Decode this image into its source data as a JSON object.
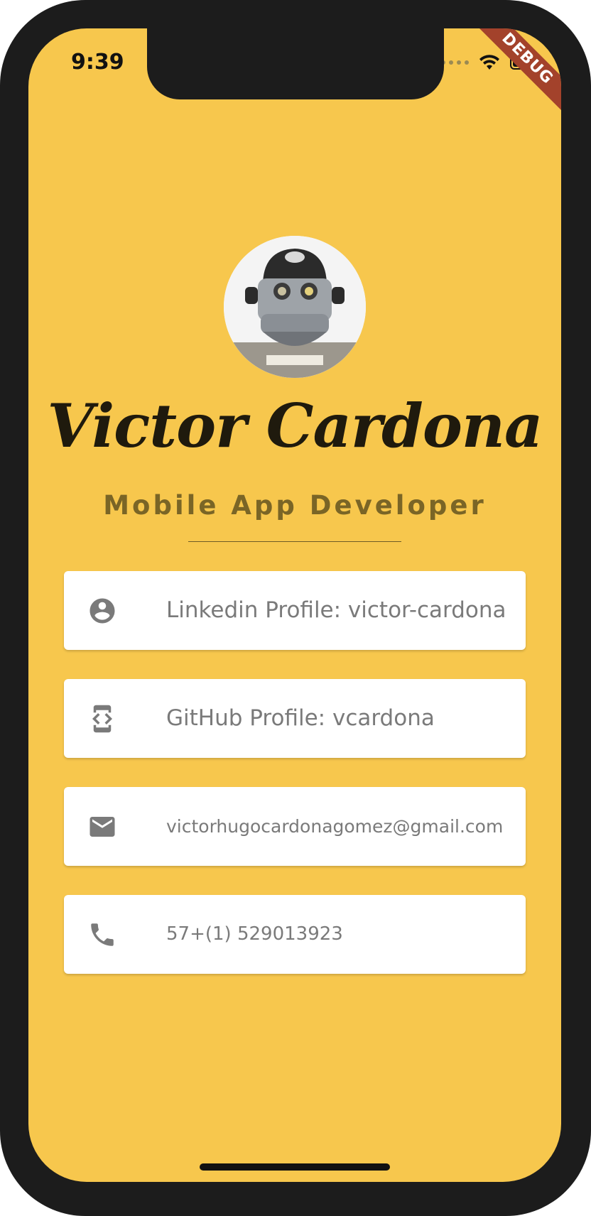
{
  "status_bar": {
    "time": "9:39"
  },
  "debug_banner": "DEBUG",
  "profile": {
    "name": "Victor Cardona",
    "title": "Mobile App Developer"
  },
  "contacts": [
    {
      "icon": "account-circle-icon",
      "label": "Linkedin Profile: victor-cardona"
    },
    {
      "icon": "developer-mode-icon",
      "label": "GitHub Profile: vcardona"
    },
    {
      "icon": "email-icon",
      "label": "victorhugocardonagomez@gmail.com"
    },
    {
      "icon": "phone-icon",
      "label": "57+(1) 529013923"
    }
  ],
  "colors": {
    "background": "#f7c74d",
    "card": "#ffffff",
    "name_text": "#1f1a0d",
    "title_text": "#7a6526",
    "icon": "#7a7a7a",
    "debug_ribbon": "#a3422b"
  }
}
